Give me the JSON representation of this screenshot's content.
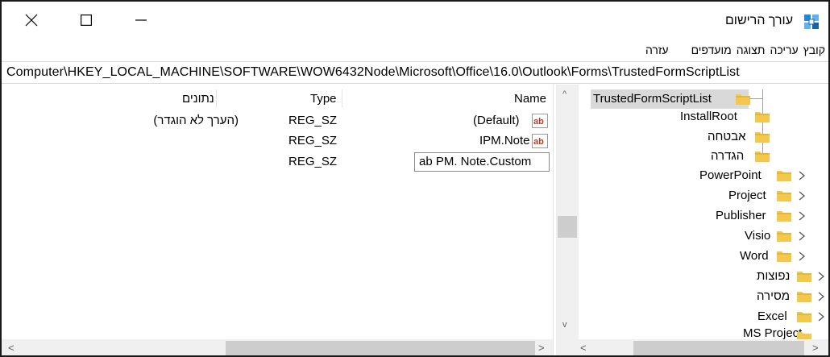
{
  "window": {
    "title": "עורך הרישום",
    "controls": {
      "close": "close-icon",
      "maximize": "maximize-icon",
      "minimize": "minimize-icon"
    }
  },
  "menu": {
    "file": "קובץ",
    "edit": "עריכה",
    "view": "תצוגה",
    "favorites": "מועדפים",
    "help": "עזרה"
  },
  "address": "Computer\\HKEY_LOCAL_MACHINE\\SOFTWARE\\WOW6432Node\\Microsoft\\Office\\16.0\\Outlook\\Forms\\TrustedFormScriptList",
  "list": {
    "columns": {
      "name": "Name",
      "type": "Type",
      "data": "נתונים"
    },
    "rows": [
      {
        "name": "(Default)",
        "type": "REG_SZ",
        "data": "(הערך לא הוגדר)"
      },
      {
        "name": "IPM.Note",
        "type": "REG_SZ",
        "data": ""
      },
      {
        "name": "",
        "type": "REG_SZ",
        "data": ""
      }
    ],
    "editing_value": "ab PM. Note.Custom"
  },
  "tree": {
    "items": [
      {
        "label": "TrustedFormScriptList",
        "selected": true
      },
      {
        "label": "InstallRoot"
      },
      {
        "label": "אבטחה"
      },
      {
        "label": "הגדרה"
      },
      {
        "label": "PowerPoint"
      },
      {
        "label": "Project"
      },
      {
        "label": "Publisher"
      },
      {
        "label": "Visio"
      },
      {
        "label": "Word"
      },
      {
        "label": "נפוצות"
      },
      {
        "label": "מסירה"
      },
      {
        "label": "Excel"
      },
      {
        "label": "MS Project"
      }
    ]
  },
  "colors": {
    "folder": "#f2c94c",
    "folder_dark": "#d9a520",
    "selection": "#d9d9d9",
    "scrollbar": "#f0f0f0",
    "thumb": "#cdcdcd",
    "ab_icon": "#c0392b"
  }
}
